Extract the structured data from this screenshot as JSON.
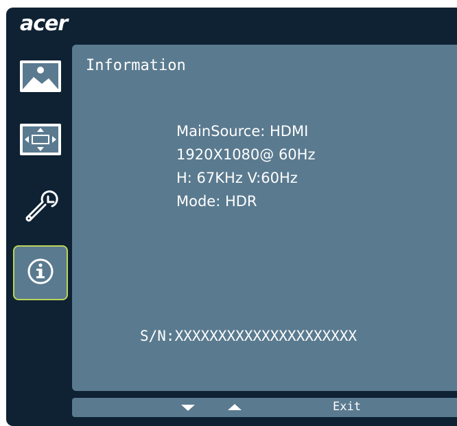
{
  "brand": {
    "logo_text": "acer"
  },
  "sidebar": {
    "items": [
      {
        "icon": "picture-icon",
        "selected": false
      },
      {
        "icon": "display-position-icon",
        "selected": false
      },
      {
        "icon": "wrench-settings-icon",
        "selected": false
      },
      {
        "icon": "info-icon",
        "selected": true
      }
    ],
    "selected_border_color": "#bcd45a"
  },
  "panel": {
    "title": "Information",
    "lines": [
      "MainSource: HDMI",
      "1920X1080@ 60Hz",
      "H: 67KHz V:60Hz",
      "Mode: HDR"
    ],
    "serial": "S/N:XXXXXXXXXXXXXXXXXXXXX"
  },
  "bottom_bar": {
    "down_icon": "down-arrow-icon",
    "up_icon": "up-arrow-icon",
    "exit_label": "Exit"
  },
  "colors": {
    "background": "#0e2233",
    "panel": "#5a7a8f",
    "accent": "#bcd45a",
    "text": "#ffffff"
  }
}
